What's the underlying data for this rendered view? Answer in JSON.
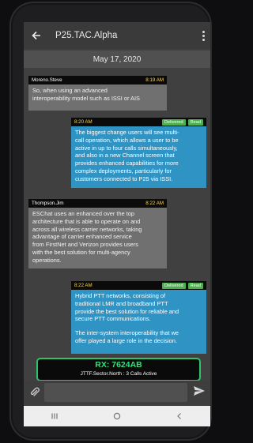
{
  "header": {
    "title": "P25.TAC.Alpha"
  },
  "date_label": "May 17, 2020",
  "messages": [
    {
      "sender": "Moreno.Steve",
      "time": "8:19 AM",
      "lines": [
        "So, when using an advanced",
        "interoperability model such as ISSI or AIS"
      ]
    },
    {
      "time": "8:20 AM",
      "status": [
        "Delivered",
        "Read"
      ],
      "lines": [
        "The biggest change users will see multi-",
        "call operation, which allows a user to be",
        "active in up to four calls simultaneously,",
        "and also in a new Channel screen that",
        "provides enhanced capabilities for more",
        "complex deployments, particularly for",
        "customers connected to P25  via ISSI."
      ]
    },
    {
      "sender": "Thompson.Jim",
      "time": "8:22 AM",
      "lines": [
        "ESChat uses an enhanced over the top",
        "architecture that is able to operate on and",
        "across all wireless carrier networks, taking",
        "advantage of carrier enhanced service",
        "from FirstNet and Verizon provides users",
        "with the best solution for multi-agency",
        "operations."
      ]
    },
    {
      "time": "8:22 AM",
      "status": [
        "Delivered",
        "Read"
      ],
      "lines": [
        "Hybrid PTT networks, consisting of",
        "traditional LMR and broadband PTT",
        "provide the best solution for reliable and",
        "secure PTT communications."
      ],
      "lines2": [
        "The inter-system interoperability that we",
        "offer played a large role in the decision."
      ]
    }
  ],
  "rx_panel": {
    "rx_id": "RX: 7624AB",
    "info": "JTTF.Sector.North  :  3 Calls Active"
  },
  "colors": {
    "accent_green": "#35e07a",
    "outgoing_bubble": "#2f93c4",
    "incoming_bubble": "#707070",
    "time_label": "#ffd54a"
  },
  "icons": [
    "back-arrow-icon",
    "more-vert-icon",
    "paperclip-icon",
    "send-icon",
    "recents-icon",
    "home-icon",
    "back-nav-icon"
  ]
}
